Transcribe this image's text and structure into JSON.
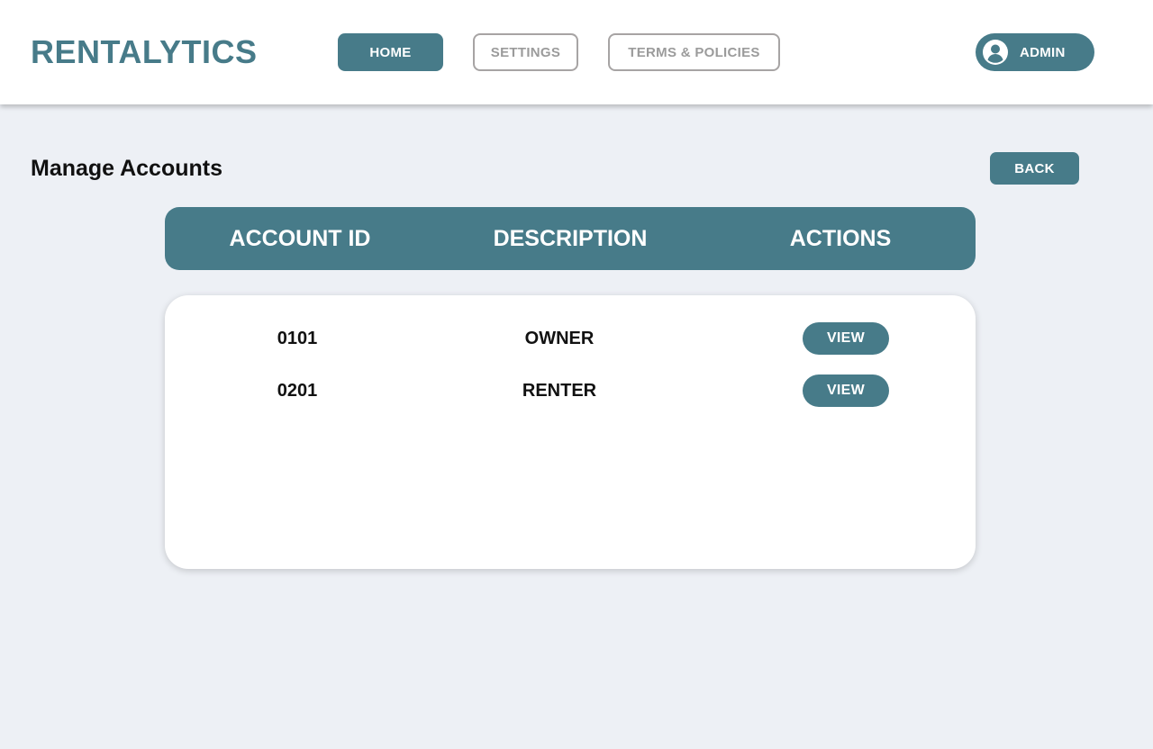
{
  "brand": {
    "name": "RENTALYTICS",
    "accent_color": "#477b89"
  },
  "nav": {
    "home": "HOME",
    "settings": "SETTINGS",
    "terms": "TERMS & POLICIES"
  },
  "user": {
    "label": "ADMIN",
    "icon": "user-circle-icon"
  },
  "page": {
    "title": "Manage Accounts",
    "back_label": "BACK"
  },
  "table": {
    "columns": [
      "ACCOUNT ID",
      "DESCRIPTION",
      "ACTIONS"
    ],
    "rows": [
      {
        "id": "0101",
        "description": "OWNER",
        "action": "VIEW"
      },
      {
        "id": "0201",
        "description": "RENTER",
        "action": "VIEW"
      }
    ]
  }
}
